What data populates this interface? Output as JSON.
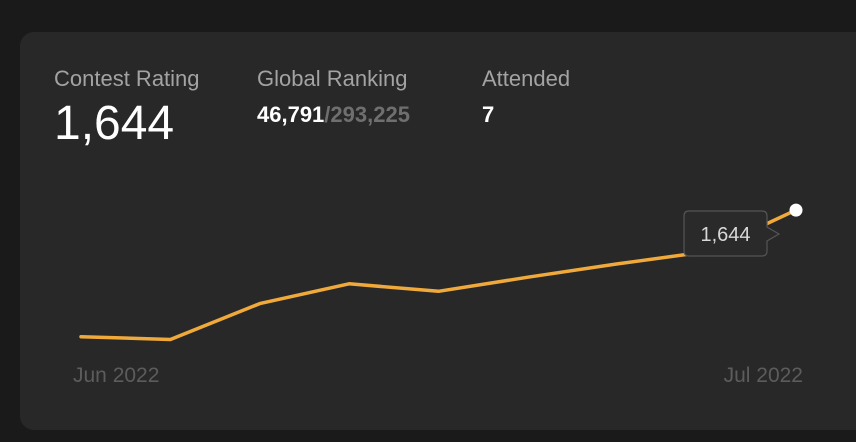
{
  "stats": {
    "contest_rating": {
      "label": "Contest Rating",
      "value": "1,644"
    },
    "global_ranking": {
      "label": "Global Ranking",
      "rank": "46,791",
      "separator": "/",
      "total": "293,225"
    },
    "attended": {
      "label": "Attended",
      "value": "7"
    }
  },
  "tooltip": {
    "value": "1,644"
  },
  "colors": {
    "line": "#f0a93b",
    "point": "#ffffff",
    "card": "#282828",
    "background": "#1a1a1a"
  },
  "chart_data": {
    "type": "line",
    "x_start_label": "Jun 2022",
    "x_end_label": "Jul 2022",
    "series": [
      {
        "values": [
          1510,
          1507,
          1545,
          1566,
          1558,
          1573,
          1587,
          1600,
          1644
        ]
      }
    ],
    "ylim": [
      1480,
      1660
    ],
    "grid": false
  }
}
